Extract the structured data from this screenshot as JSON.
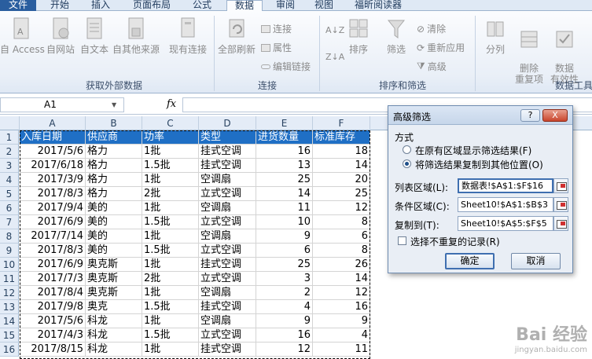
{
  "ribbon": {
    "tabs": [
      {
        "label": "文件"
      },
      {
        "label": "开始"
      },
      {
        "label": "插入"
      },
      {
        "label": "页面布局"
      },
      {
        "label": "公式"
      },
      {
        "label": "数据"
      },
      {
        "label": "审阅"
      },
      {
        "label": "视图"
      },
      {
        "label": "福昕阅读器"
      }
    ],
    "active_tab": "数据",
    "groups": {
      "external": {
        "label": "获取外部数据",
        "buttons": [
          "自 Access",
          "自网站",
          "自文本",
          "自其他来源",
          "现有连接"
        ]
      },
      "connections": {
        "label": "连接",
        "refresh": "全部刷新",
        "small": [
          "连接",
          "属性",
          "编辑链接"
        ]
      },
      "sortfilter": {
        "label": "排序和筛选",
        "sort": "排序",
        "filter": "筛选",
        "small": [
          "清除",
          "重新应用",
          "高级"
        ]
      },
      "datatools": {
        "label": "数据工具",
        "split": "分列",
        "remove_dup": "删除\n重复项",
        "validate": "数据\n有效性"
      }
    }
  },
  "formula_bar": {
    "name_box": "A1",
    "fx": "fx"
  },
  "sheet": {
    "columns": [
      "A",
      "B",
      "C",
      "D",
      "E",
      "F"
    ],
    "row_numbers": [
      "1",
      "2",
      "3",
      "4",
      "5",
      "6",
      "7",
      "8",
      "9",
      "10",
      "11",
      "12",
      "13",
      "14",
      "15",
      "16"
    ],
    "header_row": [
      "入库日期",
      "供应商",
      "功率",
      "类型",
      "进货数量",
      "标准库存"
    ],
    "rows": [
      [
        "2017/5/6",
        "格力",
        "1批",
        "挂式空调",
        "16",
        "18"
      ],
      [
        "2017/6/18",
        "格力",
        "1.5批",
        "挂式空调",
        "13",
        "14"
      ],
      [
        "2017/3/9",
        "格力",
        "1批",
        "空调扇",
        "25",
        "20"
      ],
      [
        "2017/8/3",
        "格力",
        "2批",
        "立式空调",
        "14",
        "25"
      ],
      [
        "2017/9/4",
        "美的",
        "1批",
        "空调扇",
        "11",
        "12"
      ],
      [
        "2017/6/9",
        "美的",
        "1.5批",
        "立式空调",
        "10",
        "8"
      ],
      [
        "2017/7/14",
        "美的",
        "1批",
        "空调扇",
        "9",
        "6"
      ],
      [
        "2017/8/3",
        "美的",
        "1.5批",
        "立式空调",
        "6",
        "8"
      ],
      [
        "2017/6/9",
        "奥克斯",
        "1批",
        "挂式空调",
        "25",
        "26"
      ],
      [
        "2017/7/3",
        "奥克斯",
        "2批",
        "立式空调",
        "3",
        "14"
      ],
      [
        "2017/8/4",
        "奥克斯",
        "1批",
        "空调扇",
        "2",
        "12"
      ],
      [
        "2017/9/8",
        "奥克",
        "1.5批",
        "挂式空调",
        "4",
        "16"
      ],
      [
        "2017/5/6",
        "科龙",
        "1批",
        "空调扇",
        "9",
        "9"
      ],
      [
        "2017/4/3",
        "科龙",
        "1.5批",
        "立式空调",
        "16",
        "4"
      ],
      [
        "2017/8/15",
        "科龙",
        "1批",
        "挂式空调",
        "12",
        "11"
      ]
    ]
  },
  "dialog": {
    "title": "高级筛选",
    "help": "?",
    "close": "X",
    "method_label": "方式",
    "option_inplace": "在原有区域显示筛选结果(F)",
    "option_copy": "将筛选结果复制到其他位置(O)",
    "list_range_label": "列表区域(L):",
    "list_range_value": "数据表!$A$1:$F$16",
    "criteria_range_label": "条件区域(C):",
    "criteria_range_value": "Sheet10!$A$1:$B$3",
    "copy_to_label": "复制到(T):",
    "copy_to_value": "Sheet10!$A$5:$F$5",
    "unique_label": "选择不重复的记录(R)",
    "ok": "确定",
    "cancel": "取消"
  },
  "watermark": {
    "brand": "Bai 经验",
    "url": "jingyan.baidu.com"
  }
}
